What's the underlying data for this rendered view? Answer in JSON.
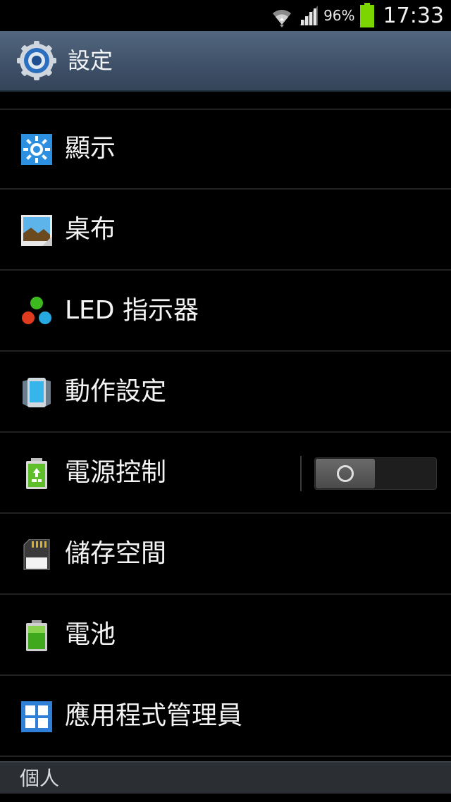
{
  "status": {
    "battery_percent": "96%",
    "time": "17:33",
    "battery_level": 0.96
  },
  "actionbar": {
    "title": "設定",
    "icon": "settings-gear-icon"
  },
  "items": [
    {
      "label": "顯示",
      "icon": "display-brightness-icon"
    },
    {
      "label": "桌布",
      "icon": "wallpaper-icon"
    },
    {
      "label": "LED 指示器",
      "icon": "led-indicator-icon"
    },
    {
      "label": "動作設定",
      "icon": "motion-icon"
    },
    {
      "label": "電源控制",
      "icon": "power-saving-icon",
      "toggle": false
    },
    {
      "label": "儲存空間",
      "icon": "storage-icon"
    },
    {
      "label": "電池",
      "icon": "battery-icon"
    },
    {
      "label": "應用程式管理員",
      "icon": "app-manager-icon"
    }
  ],
  "section": {
    "label": "個人"
  },
  "colors": {
    "actionbar": "#3e5068",
    "background": "#000000",
    "accent_battery": "#7cd400"
  }
}
